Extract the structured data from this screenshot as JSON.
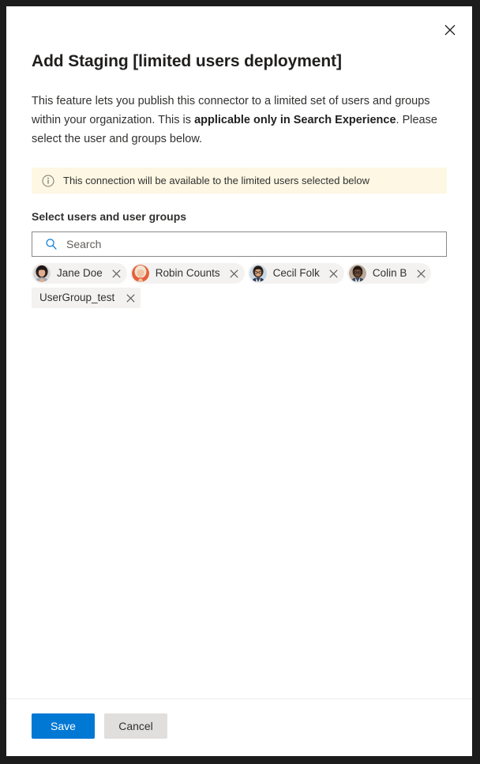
{
  "panel": {
    "close_label": "Close",
    "title": "Add Staging [limited users deployment]",
    "intro_part1": "This feature lets you publish this connector to a limited set of users and groups within your organization. This is ",
    "intro_emphasis": "applicable only in Search Experience",
    "intro_part2": ". Please select the user and groups below."
  },
  "info_bar": {
    "icon": "info-circle-icon",
    "message": "This connection will be available to the limited users selected below",
    "background_color": "#fdf7e3"
  },
  "picker": {
    "label": "Select users and user groups",
    "search_icon": "search-icon",
    "search_value": "",
    "search_placeholder": "Search",
    "selected": [
      {
        "name": "Jane Doe",
        "type": "person",
        "avatar": "photo-jane-doe",
        "remove_label": "Remove Jane Doe"
      },
      {
        "name": "Robin Counts",
        "type": "person",
        "avatar": "photo-robin-counts",
        "remove_label": "Remove Robin Counts"
      },
      {
        "name": "Cecil Folk",
        "type": "person",
        "avatar": "photo-cecil-folk",
        "remove_label": "Remove Cecil Folk"
      },
      {
        "name": "Colin B",
        "type": "person",
        "avatar": "photo-colin-b",
        "remove_label": "Remove Colin B"
      },
      {
        "name": "UserGroup_test",
        "type": "group",
        "avatar": null,
        "remove_label": "Remove UserGroup_test"
      }
    ]
  },
  "footer": {
    "save_label": "Save",
    "cancel_label": "Cancel",
    "primary_color": "#0078d4",
    "secondary_color": "#e1dfdd"
  }
}
